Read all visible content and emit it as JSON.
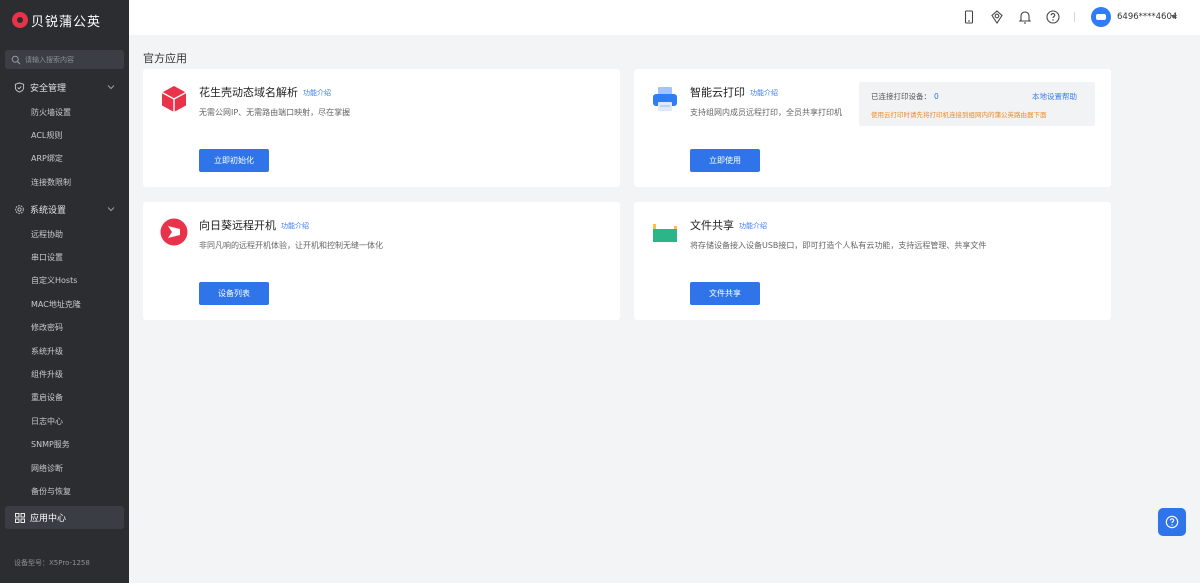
{
  "brand": {
    "name": "贝锐蒲公英"
  },
  "search": {
    "placeholder": "请输入搜索内容"
  },
  "sidebar": {
    "security": {
      "label": "安全管理",
      "items": [
        "防火墙设置",
        "ACL规则",
        "ARP绑定",
        "连接数限制"
      ]
    },
    "system": {
      "label": "系统设置",
      "items": [
        "远程协助",
        "串口设置",
        "自定义Hosts",
        "MAC地址克隆",
        "修改密码",
        "系统升级",
        "组件升级",
        "重启设备",
        "日志中心",
        "SNMP服务",
        "网络诊断",
        "备份与恢复"
      ]
    },
    "active": {
      "label": "应用中心"
    },
    "device_model": "设备型号：X5Pro-1258"
  },
  "topbar": {
    "icons": [
      "mobile-icon",
      "route-icon",
      "bell-icon",
      "help-circle-icon"
    ],
    "username": "6496****4604"
  },
  "main": {
    "section_title": "官方应用",
    "cards": {
      "ddns": {
        "title": "花生壳动态域名解析",
        "link": "功能介绍",
        "desc": "无需公网IP、无需路由端口映射，尽在掌握",
        "button": "立即初始化"
      },
      "print": {
        "title": "智能云打印",
        "link": "功能介绍",
        "desc": "支持组网内成员远程打印，全员共享打印机",
        "button": "立即使用",
        "info": {
          "label": "已连接打印设备：",
          "count": "0",
          "help": "本地设置帮助",
          "warning": "使用云打印时请先将打印机连接到组网内的蒲公英路由器下面"
        }
      },
      "wol": {
        "title": "向日葵远程开机",
        "link": "功能介绍",
        "desc": "非同凡响的远程开机体验，让开机和控制无缝一体化",
        "button": "设备列表"
      },
      "share": {
        "title": "文件共享",
        "link": "功能介绍",
        "desc": "将存储设备接入设备USB接口，即可打造个人私有云功能，支持远程管理、共享文件",
        "button": "文件共享"
      }
    }
  },
  "colors": {
    "sidebar_bg": "#2b2d31",
    "primary": "#2f74e8",
    "brand_red": "#e8334a",
    "warning": "#f08a24"
  }
}
